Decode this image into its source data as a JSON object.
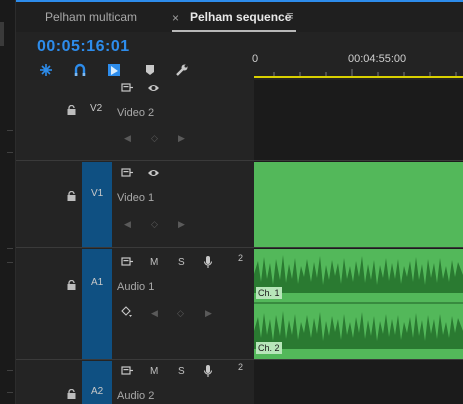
{
  "tabs": {
    "multicam_label": "Pelham multicam",
    "close_glyph": "×",
    "sequence_label": "Pelham sequence",
    "menu_glyph": "≡"
  },
  "timecode": "00:05:16:01",
  "tools": [
    "snap-icon",
    "linked-selection-icon",
    "add-marker-icon",
    "marker-icon",
    "wrench-settings-icon"
  ],
  "ruler": {
    "labels": [
      "0",
      "00:04:55:00"
    ]
  },
  "tracks": {
    "v2": {
      "id": "V2",
      "name": "Video 2"
    },
    "v1": {
      "id": "V1",
      "name": "Video 1"
    },
    "a1": {
      "id": "A1",
      "name": "Audio 1",
      "channels": "2",
      "m": "M",
      "s": "S"
    },
    "a2": {
      "id": "A2",
      "name": "Audio 2",
      "channels": "2",
      "m": "M",
      "s": "S"
    }
  },
  "clips": {
    "audio_ch1": "Ch. 1",
    "audio_ch2": "Ch. 2"
  },
  "colors": {
    "accent": "#2d8ceb",
    "clip_green": "#53b85a",
    "playhead_bar": "#d9d000",
    "target_patch": "#0f5082"
  }
}
